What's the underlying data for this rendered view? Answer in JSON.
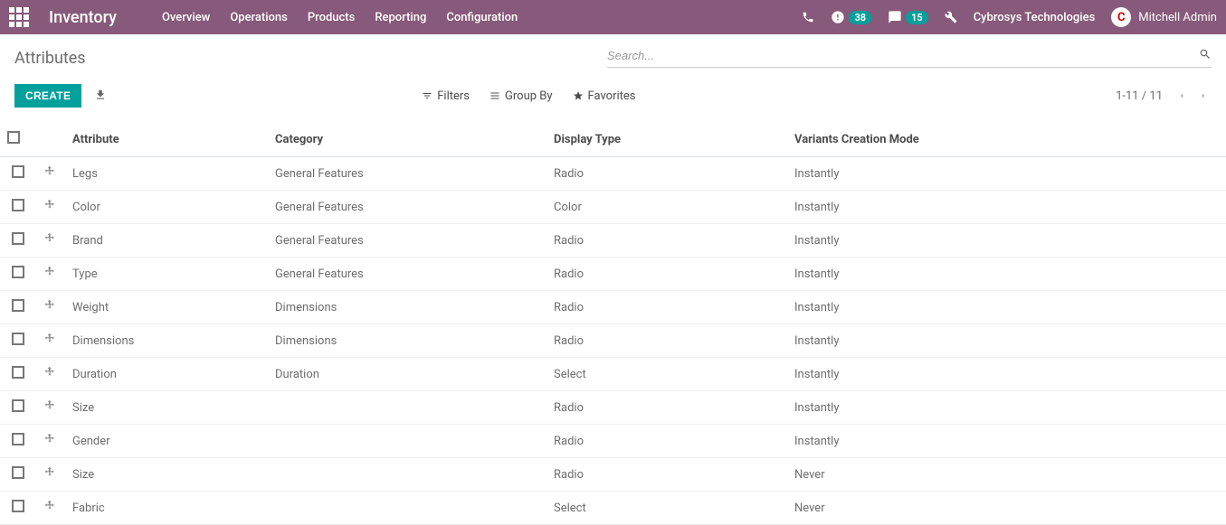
{
  "topbar": {
    "app_title": "Inventory",
    "nav": [
      "Overview",
      "Operations",
      "Products",
      "Reporting",
      "Configuration"
    ],
    "clock_badge": "38",
    "chat_badge": "15",
    "company": "Cybrosys Technologies",
    "user_name": "Mitchell Admin",
    "avatar_letter": "C"
  },
  "page": {
    "title": "Attributes",
    "search_placeholder": "Search...",
    "create_label": "CREATE",
    "filters_label": "Filters",
    "groupby_label": "Group By",
    "favorites_label": "Favorites",
    "pager_text": "1-11 / 11"
  },
  "columns": {
    "attribute": "Attribute",
    "category": "Category",
    "display_type": "Display Type",
    "variants_mode": "Variants Creation Mode"
  },
  "rows": [
    {
      "attribute": "Legs",
      "category": "General Features",
      "display_type": "Radio",
      "variants_mode": "Instantly"
    },
    {
      "attribute": "Color",
      "category": "General Features",
      "display_type": "Color",
      "variants_mode": "Instantly"
    },
    {
      "attribute": "Brand",
      "category": "General Features",
      "display_type": "Radio",
      "variants_mode": "Instantly"
    },
    {
      "attribute": "Type",
      "category": "General Features",
      "display_type": "Radio",
      "variants_mode": "Instantly"
    },
    {
      "attribute": "Weight",
      "category": "Dimensions",
      "display_type": "Radio",
      "variants_mode": "Instantly"
    },
    {
      "attribute": "Dimensions",
      "category": "Dimensions",
      "display_type": "Radio",
      "variants_mode": "Instantly"
    },
    {
      "attribute": "Duration",
      "category": "Duration",
      "display_type": "Select",
      "variants_mode": "Instantly"
    },
    {
      "attribute": "Size",
      "category": "",
      "display_type": "Radio",
      "variants_mode": "Instantly"
    },
    {
      "attribute": "Gender",
      "category": "",
      "display_type": "Radio",
      "variants_mode": "Instantly"
    },
    {
      "attribute": "Size",
      "category": "",
      "display_type": "Radio",
      "variants_mode": "Never"
    },
    {
      "attribute": "Fabric",
      "category": "",
      "display_type": "Select",
      "variants_mode": "Never"
    }
  ]
}
